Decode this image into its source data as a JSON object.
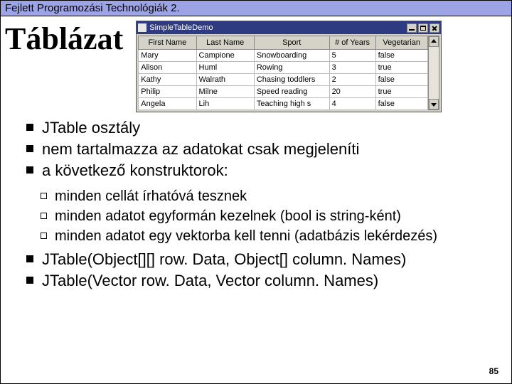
{
  "header": "Fejlett Programozási Technológiák 2.",
  "title": "Táblázat",
  "demo": {
    "window_title": "SimpleTableDemo",
    "columns": [
      "First Name",
      "Last Name",
      "Sport",
      "# of Years",
      "Vegetarian"
    ],
    "rows": [
      [
        "Mary",
        "Campione",
        "Snowboarding",
        "5",
        "false"
      ],
      [
        "Alison",
        "Huml",
        "Rowing",
        "3",
        "true"
      ],
      [
        "Kathy",
        "Walrath",
        "Chasing toddlers",
        "2",
        "false"
      ],
      [
        "Philip",
        "Milne",
        "Speed reading",
        "20",
        "true"
      ],
      [
        "Angela",
        "Lih",
        "Teaching high s",
        "4",
        "false"
      ]
    ]
  },
  "bullets1": [
    "JTable osztály",
    "nem tartalmazza az adatokat csak megjeleníti",
    "a következő konstruktorok:"
  ],
  "subbullets": [
    "minden cellát írhatóvá tesznek",
    "minden adatot egyformán kezelnek (bool is string-ként)",
    "minden adatot egy vektorba kell tenni (adatbázis lekérdezés)"
  ],
  "bullets2": [
    "JTable(Object[][] row. Data, Object[] column. Names)",
    "JTable(Vector row. Data, Vector column. Names)"
  ],
  "page_number": "85"
}
